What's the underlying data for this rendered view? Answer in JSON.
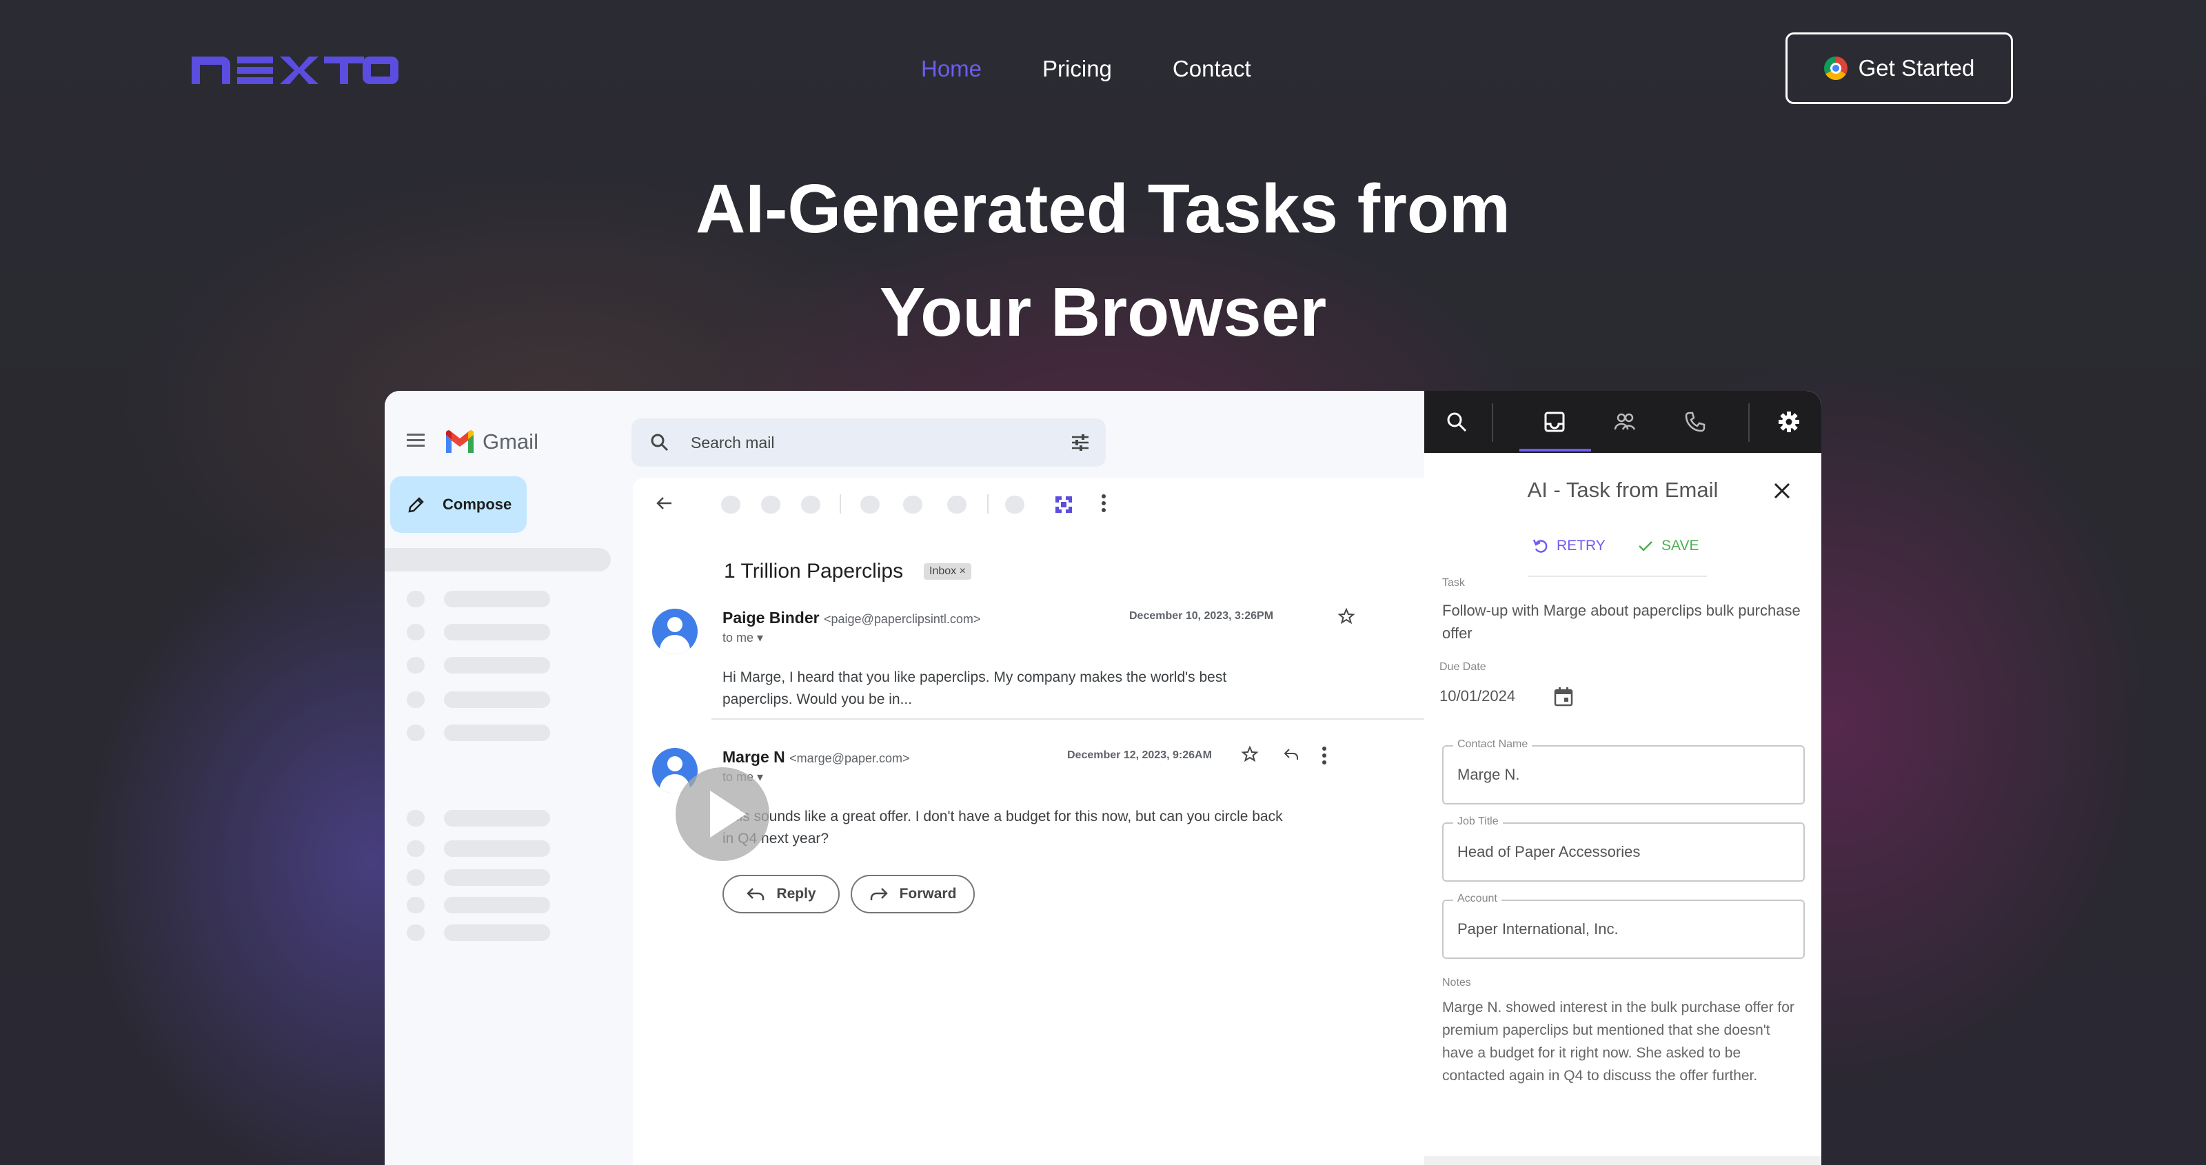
{
  "nav": {
    "links": [
      {
        "label": "Home",
        "active": true
      },
      {
        "label": "Pricing",
        "active": false
      },
      {
        "label": "Contact",
        "active": false
      }
    ],
    "cta_label": "Get Started"
  },
  "hero": {
    "title_line1": "AI-Generated Tasks from",
    "title_line2": "Your Browser"
  },
  "gmail": {
    "brand": "Gmail",
    "compose_label": "Compose",
    "search_placeholder": "Search mail",
    "subject": "1 Trillion Paperclips",
    "inbox_tag": "Inbox ×",
    "messages": [
      {
        "sender_name": "Paige Binder",
        "sender_email": "<paige@paperclipsintl.com>",
        "to": "to me ▾",
        "date": "December 10, 2023, 3:26PM",
        "body": "Hi Marge, I heard that you like paperclips. My company makes the world's best paperclips. Would you be in..."
      },
      {
        "sender_name": "Marge N",
        "sender_email": "<marge@paper.com>",
        "to": "to me ▾",
        "date": "December 12, 2023, 9:26AM",
        "body": "This sounds like a great offer. I don't have a budget for this now, but can you circle back in Q4 next year?"
      }
    ],
    "reply_label": "Reply",
    "forward_label": "Forward"
  },
  "task_panel": {
    "title": "AI - Task from Email",
    "retry_label": "RETRY",
    "save_label": "SAVE",
    "task_label": "Task",
    "task_value": "Follow-up with Marge about paperclips bulk purchase offer",
    "due_label": "Due Date",
    "due_value": "10/01/2024",
    "contact_label": "Contact Name",
    "contact_value": "Marge N.",
    "job_label": "Job Title",
    "job_value": "Head of Paper Accessories",
    "account_label": "Account",
    "account_value": "Paper International, Inc.",
    "notes_label": "Notes",
    "notes_value": "Marge N. showed interest in the bulk purchase offer for premium paperclips but mentioned that she doesn't have a budget for it right now. She asked to be contacted again in Q4 to discuss the offer further."
  },
  "colors": {
    "accent": "#6d5cf3",
    "save_green": "#4caf50",
    "avatar_blue": "#3f7ee8",
    "compose_bg": "#c2e7ff"
  }
}
